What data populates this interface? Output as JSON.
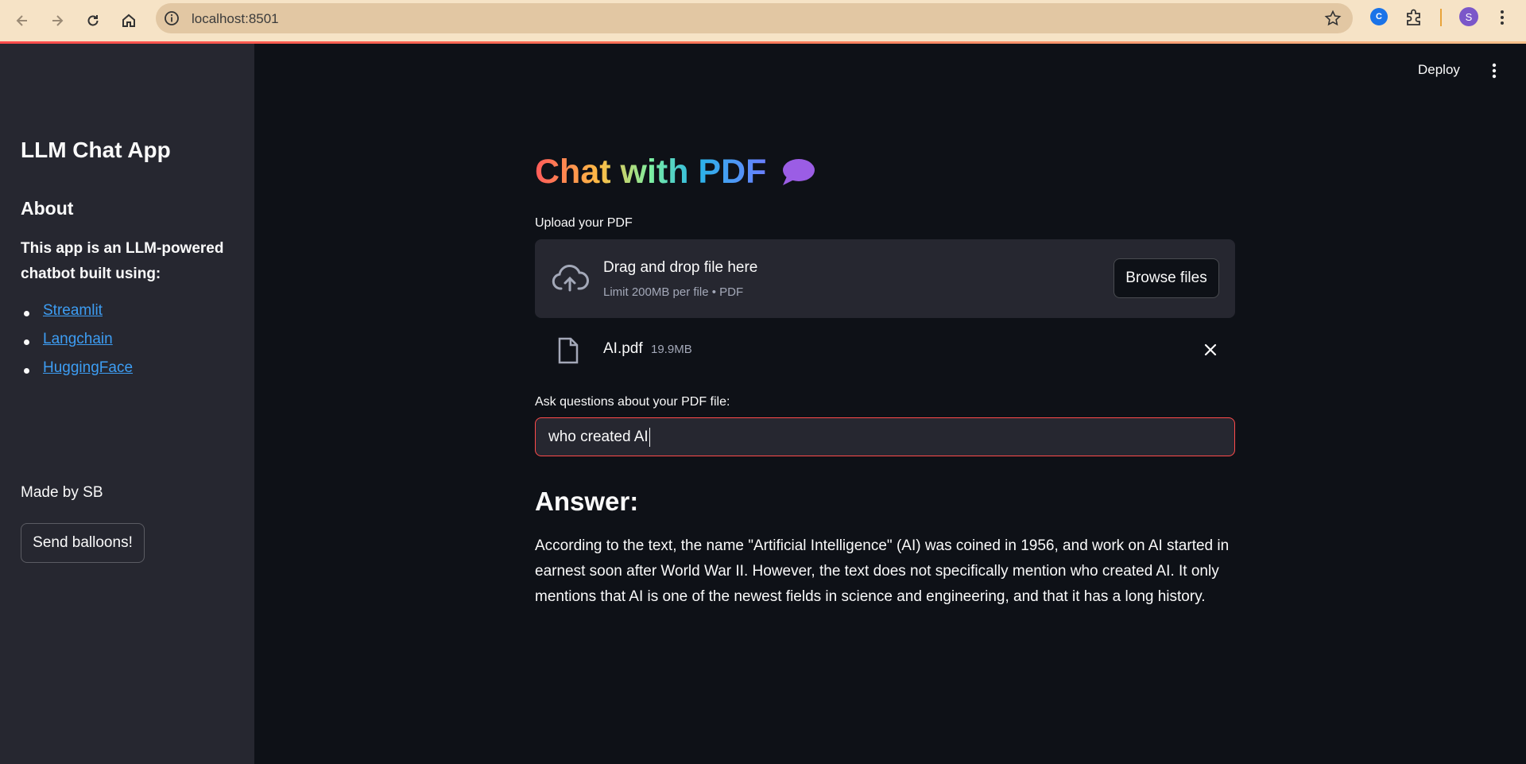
{
  "browser": {
    "url": "localhost:8501",
    "profile_initial": "S",
    "extension_letter": "C"
  },
  "sidebar": {
    "title": "LLM Chat App",
    "about_heading": "About",
    "description": "This app is an LLM-powered chatbot built using:",
    "links": [
      {
        "label": "Streamlit"
      },
      {
        "label": "Langchain"
      },
      {
        "label": "HuggingFace"
      }
    ],
    "made_by": "Made by SB",
    "button_label": "Send balloons!"
  },
  "header": {
    "deploy_label": "Deploy"
  },
  "main": {
    "title": "Chat with PDF",
    "title_icon": "speech-bubble-icon",
    "upload_label": "Upload your PDF",
    "dropzone": {
      "main_text": "Drag and drop file here",
      "sub_text": "Limit 200MB per file • PDF",
      "browse_label": "Browse files"
    },
    "uploaded_file": {
      "name": "AI.pdf",
      "size": "19.9MB"
    },
    "question_label": "Ask questions about your PDF file:",
    "question_value": "who created AI",
    "answer_heading": "Answer:",
    "answer_text": "According to the text, the name \"Artificial Intelligence\" (AI) was coined in 1956, and work on AI started in earnest soon after World War II. However, the text does not specifically mention who created AI. It only mentions that AI is one of the newest fields in science and engineering, and that it has a long history."
  },
  "colors": {
    "background": "#0e1117",
    "sidebar": "#262730",
    "accent": "#ff4b4b",
    "link": "#3d9df3"
  }
}
